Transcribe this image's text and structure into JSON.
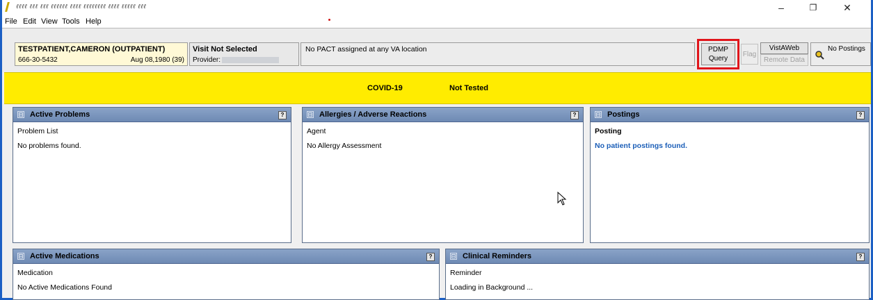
{
  "window": {
    "title": "ℓℓℓℓ ℓℓℓ ℓℓℓ ℓℓℓℓℓℓ ℓℓℓℓ ℓℓℓℓℓℓℓℓ ℓℓℓℓ ℓℓℓℓℓ ℓℓℓ",
    "min_glyph": "–",
    "max_glyph": "❐",
    "close_glyph": "✕"
  },
  "menu": [
    "File",
    "Edit",
    "View",
    "Tools",
    "Help"
  ],
  "patient": {
    "name": "TESTPATIENT,CAMERON (OUTPATIENT)",
    "ssn": "666-30-5432",
    "dob": "Aug 08,1980 (39)"
  },
  "visit": {
    "title": "Visit Not Selected",
    "provider_label": "Provider:"
  },
  "pact": "No PACT assigned at any VA location",
  "toolbar": {
    "pdmp_line1": "PDMP",
    "pdmp_line2": "Query",
    "flag": "Flag",
    "vistaweb": "VistAWeb",
    "remote_data": "Remote Data",
    "postings": "No Postings"
  },
  "covid": {
    "label": "COVID-19",
    "status": "Not Tested"
  },
  "panels": {
    "problems": {
      "title": "Active Problems",
      "col": "Problem List",
      "value": "No problems found."
    },
    "allergies": {
      "title": "Allergies / Adverse Reactions",
      "col": "Agent",
      "value": "No Allergy Assessment"
    },
    "postings": {
      "title": "Postings",
      "col": "Posting",
      "value": "No patient postings found."
    },
    "medications": {
      "title": "Active Medications",
      "col": "Medication",
      "value": "No Active Medications Found"
    },
    "reminders": {
      "title": "Clinical Reminders",
      "col": "Reminder",
      "value": "Loading in Background ..."
    }
  },
  "icons": {
    "collapse": "⊟",
    "options": "?"
  },
  "colors": {
    "covid_banner": "#ffec00",
    "panel_header": "#7891bb",
    "highlight_outline": "#e0151b",
    "posting_text": "#1c5fb8"
  }
}
